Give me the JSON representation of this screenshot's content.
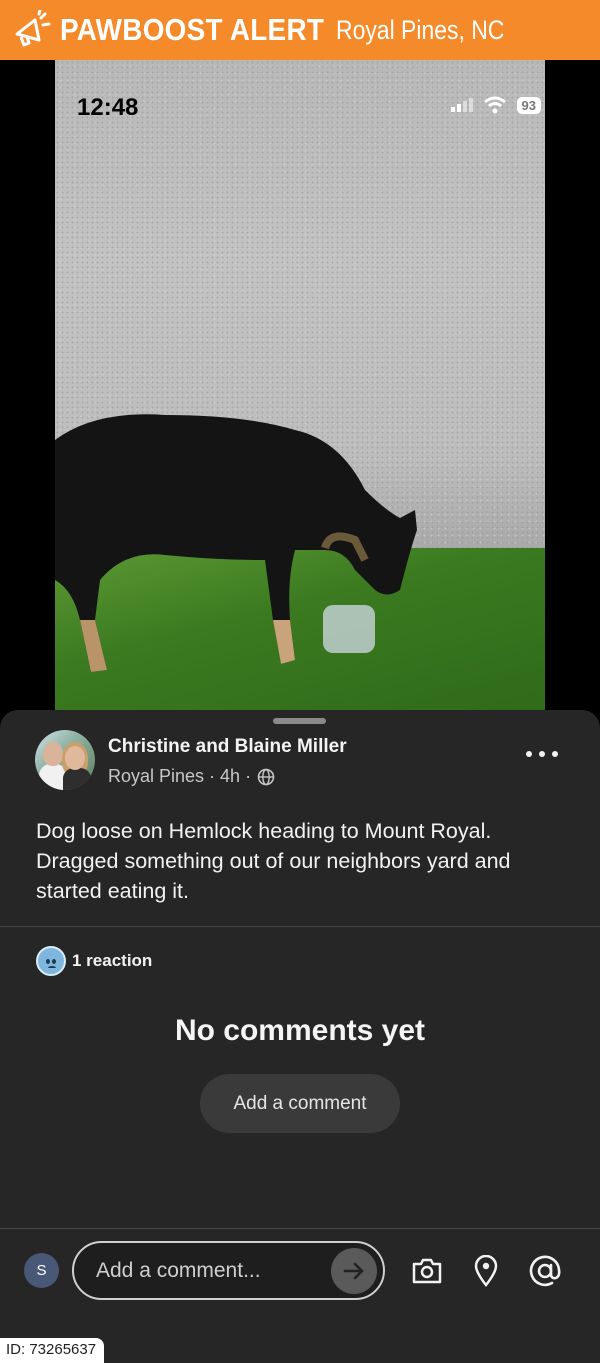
{
  "banner": {
    "brand": "PAWBOOST ALERT",
    "location": "Royal Pines, NC",
    "icon": "megaphone-icon",
    "color": "#f58a2a"
  },
  "screenshot_status": {
    "time": "12:48",
    "battery": "93"
  },
  "post": {
    "author": "Christine and Blaine Miller",
    "meta": "Royal Pines · 4h ·",
    "text": "Dog loose on Hemlock heading to Mount Royal. Dragged something out of our neighbors yard and started eating it."
  },
  "reactions": {
    "label": "1 reaction"
  },
  "comments": {
    "empty_title": "No comments yet",
    "add_label": "Add a comment"
  },
  "composer": {
    "user_initial": "S",
    "placeholder": "Add a comment..."
  },
  "footer": {
    "id_text": "ID: 73265637"
  }
}
